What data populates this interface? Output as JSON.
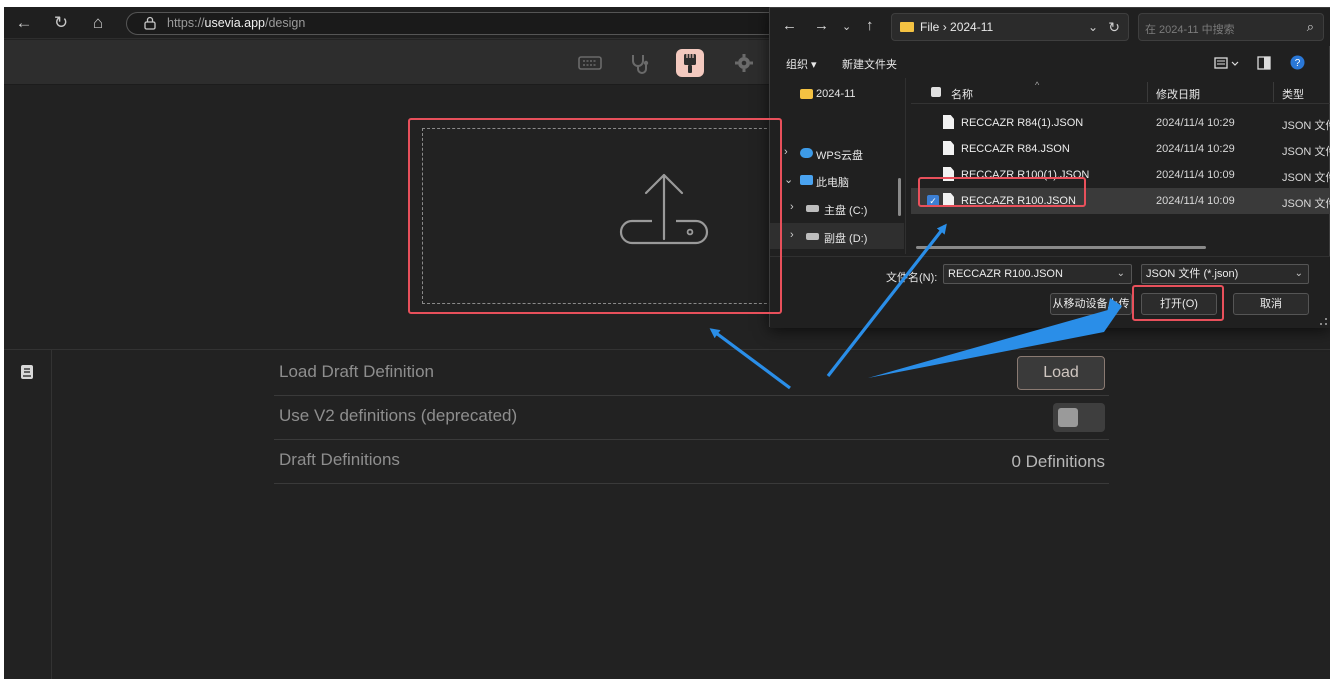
{
  "browser": {
    "url_prefix": "https://",
    "url_host": "usevia.app",
    "url_path": "/design"
  },
  "settings": {
    "load_draft_label": "Load Draft Definition",
    "load_button": "Load",
    "use_v2_label": "Use V2 definitions (deprecated)",
    "use_v2_enabled": false,
    "draft_definitions_label": "Draft Definitions",
    "draft_definitions_count": "0 Definitions"
  },
  "dialog": {
    "path_folder": "File",
    "path_sep": "›",
    "path_current": "2024-11",
    "search_placeholder": "在 2024-11 中搜索",
    "organize": "组织 ▾",
    "new_folder": "新建文件夹",
    "tree": [
      {
        "label": "2024-11",
        "icon": "folder-icon"
      },
      {
        "label": "WPS云盘",
        "icon": "cloud-icon"
      },
      {
        "label": "此电脑",
        "icon": "computer-icon"
      },
      {
        "label": "主盘 (C:)",
        "icon": "drive-icon"
      },
      {
        "label": "副盘 (D:)",
        "icon": "drive-icon"
      }
    ],
    "columns": {
      "name": "名称",
      "date": "修改日期",
      "type": "类型"
    },
    "files": [
      {
        "name": "RECCAZR R84(1).JSON",
        "date": "2024/11/4 10:29",
        "type": "JSON 文件"
      },
      {
        "name": "RECCAZR R84.JSON",
        "date": "2024/11/4 10:29",
        "type": "JSON 文件"
      },
      {
        "name": "RECCAZR R100(1).JSON",
        "date": "2024/11/4 10:09",
        "type": "JSON 文件"
      },
      {
        "name": "RECCAZR R100.JSON",
        "date": "2024/11/4 10:09",
        "type": "JSON 文件",
        "selected": true
      }
    ],
    "filename_label": "文件名(N):",
    "filename_value": "RECCAZR R100.JSON",
    "filetype_value": "JSON 文件 (*.json)",
    "mobile_upload": "从移动设备上传",
    "open_button": "打开(O)",
    "cancel_button": "取消"
  },
  "colors": {
    "annotation_red": "#e8505b",
    "annotation_blue": "#2a8ee8",
    "accent_tool": "#f3c9bf"
  }
}
